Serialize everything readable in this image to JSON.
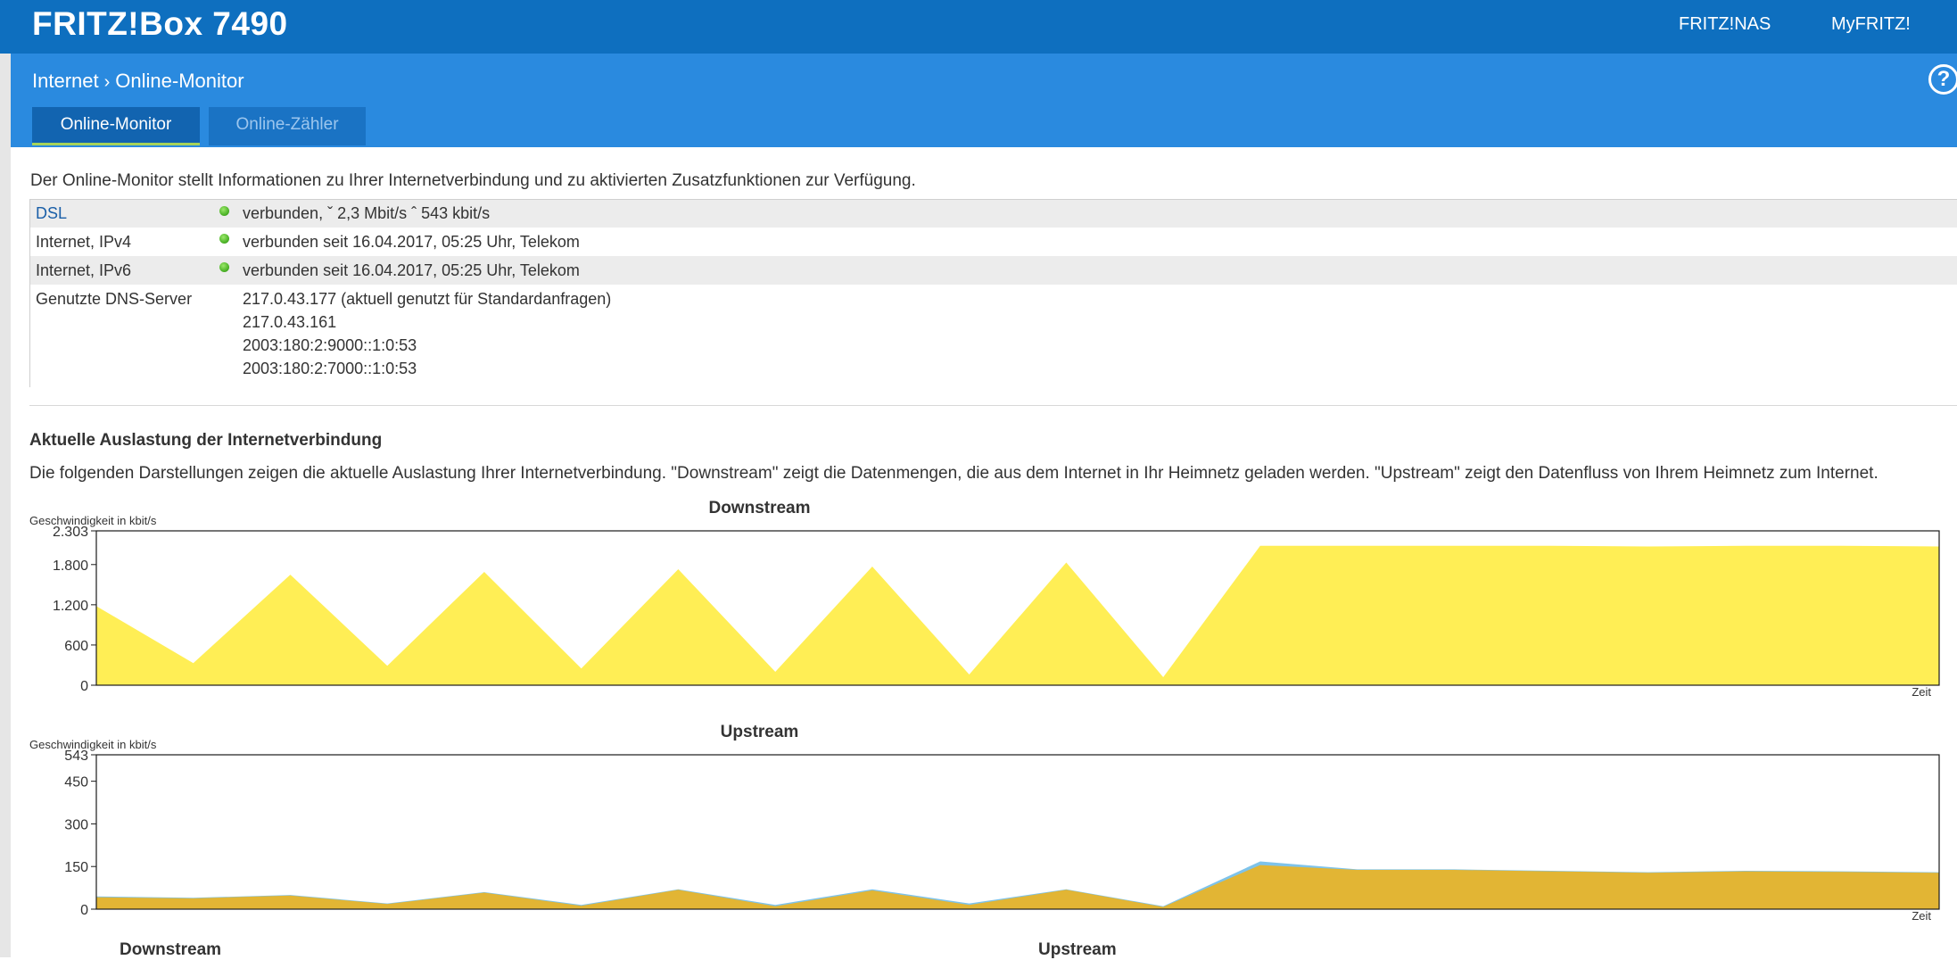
{
  "header": {
    "brand": "FRITZ!Box 7490",
    "links": {
      "fritznas": "FRITZ!NAS",
      "myfritz": "MyFRITZ!"
    }
  },
  "breadcrumb": {
    "parent": "Internet",
    "current": "Online-Monitor"
  },
  "help": "?",
  "tabs": [
    {
      "label": "Online-Monitor",
      "active": true
    },
    {
      "label": "Online-Zähler",
      "active": false
    }
  ],
  "intro": "Der Online-Monitor stellt Informationen zu Ihrer Internetverbindung und zu aktivierten Zusatzfunktionen zur Verfügung.",
  "status": {
    "dsl": {
      "label": "DSL",
      "value": "verbunden, ˇ 2,3 Mbit/s ˆ 543 kbit/s"
    },
    "ipv4": {
      "label": "Internet, IPv4",
      "value": "verbunden seit 16.04.2017, 05:25 Uhr, Telekom"
    },
    "ipv6": {
      "label": "Internet, IPv6",
      "value": "verbunden seit 16.04.2017, 05:25 Uhr, Telekom"
    },
    "dns": {
      "label": "Genutzte DNS-Server",
      "servers": [
        "217.0.43.177 (aktuell genutzt für Standardanfragen)",
        "217.0.43.161",
        "2003:180:2:9000::1:0:53",
        "2003:180:2:7000::1:0:53"
      ]
    },
    "status_color": "#4fb52a"
  },
  "section": {
    "title": "Aktuelle Auslastung der Internetverbindung",
    "description": "Die folgenden Darstellungen zeigen die aktuelle Auslastung Ihrer Internetverbindung. \"Downstream\" zeigt die Datenmengen, die aus dem Internet in Ihr Heimnetz geladen werden. \"Upstream\" zeigt den Datenfluss von Ihrem Heimnetz zum Internet."
  },
  "chart_data": [
    {
      "type": "area",
      "title": "Downstream",
      "ylabel": "Geschwindigkeit in kbit/s",
      "xlabel": "Zeit",
      "ylim": [
        0,
        2303
      ],
      "yticks": [
        "0",
        "600",
        "1.200",
        "1.800",
        "2.303"
      ],
      "grid": false,
      "x": [
        0,
        1,
        2,
        3,
        4,
        5,
        6,
        7,
        8,
        9,
        10,
        11,
        12,
        13,
        14,
        15,
        16,
        17,
        18,
        19
      ],
      "series": [
        {
          "color": "#ffee55",
          "values": [
            1180,
            330,
            1650,
            290,
            1690,
            250,
            1730,
            200,
            1770,
            160,
            1830,
            120,
            2080,
            2080,
            2080,
            2080,
            2070,
            2080,
            2080,
            2070
          ]
        }
      ],
      "frame_color": "#1a1a1a"
    },
    {
      "type": "area",
      "title": "Upstream",
      "ylabel": "Geschwindigkeit in kbit/s",
      "xlabel": "Zeit",
      "ylim": [
        0,
        543
      ],
      "yticks": [
        "0",
        "150",
        "300",
        "450",
        "543"
      ],
      "grid": false,
      "x": [
        0,
        1,
        2,
        3,
        4,
        5,
        6,
        7,
        8,
        9,
        10,
        11,
        12,
        13,
        14,
        15,
        16,
        17,
        18,
        19
      ],
      "series": [
        {
          "color": "#7ec3ea",
          "values": [
            45,
            40,
            50,
            20,
            60,
            15,
            70,
            15,
            70,
            20,
            70,
            10,
            168,
            140,
            140,
            135,
            130,
            135,
            133,
            130
          ]
        },
        {
          "color": "#e2b534",
          "values": [
            42,
            38,
            48,
            18,
            58,
            12,
            68,
            10,
            66,
            15,
            68,
            8,
            155,
            138,
            138,
            133,
            128,
            133,
            131,
            128
          ]
        }
      ]
    }
  ],
  "bottom_labels": {
    "downstream": "Downstream",
    "upstream": "Upstream"
  }
}
